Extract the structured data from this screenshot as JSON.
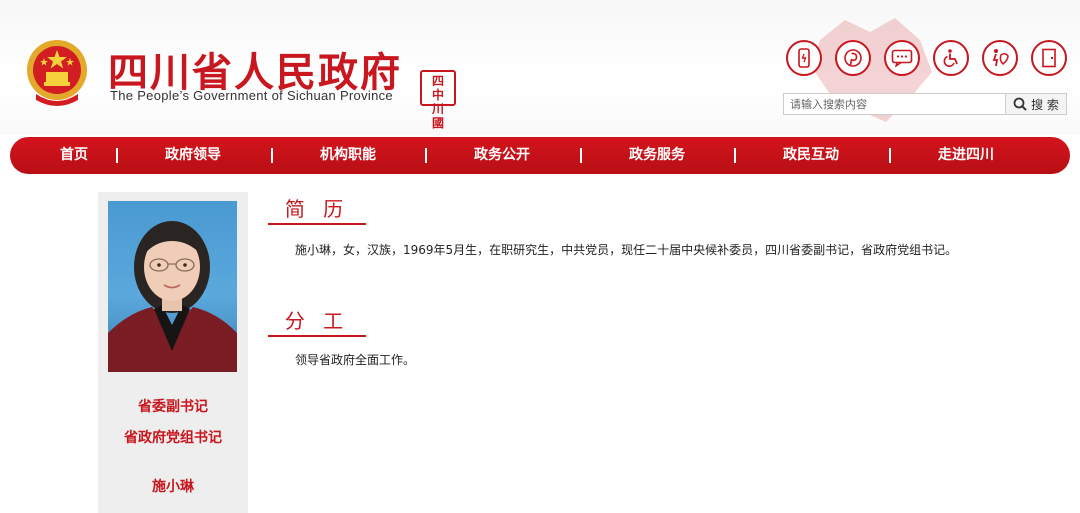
{
  "header": {
    "title_cn": "四川省人民政府",
    "title_en": "The People’s Government of Sichuan Province",
    "seal_chars": [
      "四",
      "中",
      "川",
      "國"
    ],
    "brand_color": "#c8171e"
  },
  "tools": [
    {
      "icon": "mobile-icon",
      "name": "mobile"
    },
    {
      "icon": "pinterest-icon",
      "name": "pinterest"
    },
    {
      "icon": "chat-icon",
      "name": "chat"
    },
    {
      "icon": "wheelchair-icon",
      "name": "accessibility"
    },
    {
      "icon": "elder-care-icon",
      "name": "elder-care"
    },
    {
      "icon": "exit-door-icon",
      "name": "exit"
    }
  ],
  "search": {
    "placeholder": "请输入搜索内容",
    "button_label": "搜 索"
  },
  "nav": {
    "items": [
      "首页",
      "政府领导",
      "机构职能",
      "政务公开",
      "政务服务",
      "政民互动",
      "走进四川"
    ]
  },
  "profile": {
    "role_1": "省委副书记",
    "role_2": "省政府党组书记",
    "name": "施小琳"
  },
  "resume": {
    "title": "简 历",
    "text": "施小琳，女，汉族，1969年5月生，在职研究生，中共党员，现任二十届中央候补委员，四川省委副书记，省政府党组书记。"
  },
  "duty": {
    "title": "分 工",
    "text": "领导省政府全面工作。"
  }
}
